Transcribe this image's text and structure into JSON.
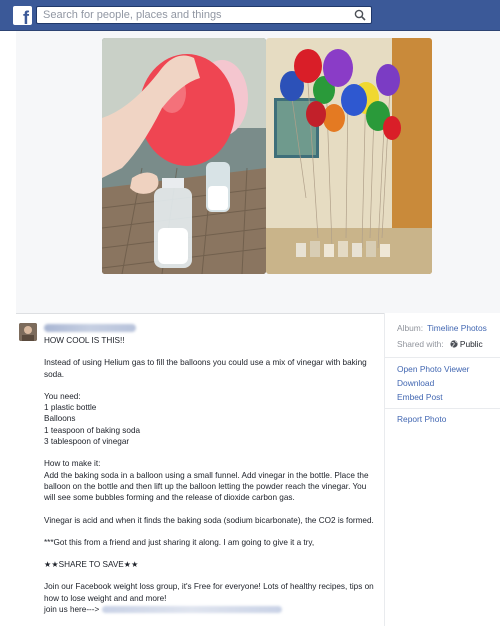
{
  "topbar": {
    "logo": "f",
    "search_placeholder": "Search for people, places and things",
    "search_icon": "magnifier-icon"
  },
  "post": {
    "paragraphs": [
      "HOW COOL IS THIS!!",
      "Instead of using Helium gas to fill the balloons you could use a mix of vinegar with baking soda.",
      "You need:\n1 plastic bottle\nBalloons\n1 teaspoon of baking soda\n3 tablespoon of vinegar",
      "How to make it:\nAdd the baking soda in a balloon using a small funnel. Add vinegar in the bottle. Place the balloon on the bottle and then lift up the balloon letting the powder reach the vinegar. You will see some bubbles forming and the release of dioxide carbon gas.",
      "Vinegar is acid and when it finds the baking soda (sodium bicarbonate), the CO2 is formed.",
      "***Got this from a friend and just sharing it along. I am going to give it a try,",
      "★★SHARE TO SAVE★★",
      "Join our Facebook weight loss group, it's Free for everyone! Lots of healthy recipes, tips on how to lose weight and and more!"
    ],
    "join_label": "join us here--->"
  },
  "sidebar": {
    "album_label": "Album:",
    "album_link": "Timeline Photos",
    "shared_label": "Shared with:",
    "shared_value": "Public",
    "actions": [
      "Open Photo Viewer",
      "Download",
      "Embed Post",
      "Report Photo"
    ]
  },
  "colors": {
    "topbar": "#3b5998",
    "link": "#4267b2",
    "text": "#1d2129",
    "muted": "#90949c"
  }
}
